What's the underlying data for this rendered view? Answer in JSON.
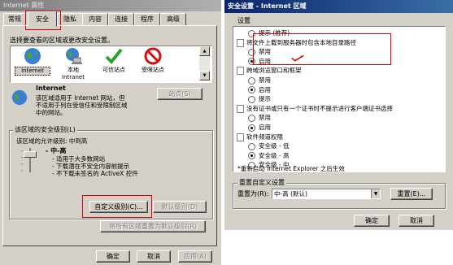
{
  "left": {
    "title": "Internet 属性",
    "tabs": [
      "常规",
      "安全",
      "隐私",
      "内容",
      "连接",
      "程序",
      "高级"
    ],
    "zone_prompt": "选择要查看的区域或更改安全设置。",
    "zones": [
      {
        "label": "Internet",
        "icon": "globe-icon"
      },
      {
        "label": "本地\nIntranet",
        "icon": "intranet-icon"
      },
      {
        "label": "可信站点",
        "icon": "checkmark-icon"
      },
      {
        "label": "受限站点",
        "icon": "restricted-icon"
      }
    ],
    "zone_title": "Internet",
    "zone_desc": "该区域适用于 Internet 网站，但\n不适用于列在受信任和受限制区域\n中的网站。",
    "sites_button": "站点(S)",
    "level_group_label": "该区域的安全级别(L)",
    "allowed_levels": "该区域的允许级别: 中到高",
    "level_name": "- 中-高",
    "level_desc": "- 适用于大多数网站\n- 下载潜在不安全内容前提示\n- 不下载未签名的 ActiveX 控件",
    "custom_button": "自定义级别(C)...",
    "default_button": "默认级别(D)",
    "reset_all_button": "将所有区域重置为默认级别(R)",
    "ok": "确定",
    "cancel": "取消",
    "apply": "应用(A)"
  },
  "right": {
    "title": "安全设置 - Internet 区域",
    "settings_label": "设置",
    "rows": [
      {
        "type": "radio",
        "on": false,
        "text": "提示 (推荐)",
        "indent": 2
      },
      {
        "type": "doc",
        "text": "将文件上载到服务器时包含本地目录路径",
        "indent": 1
      },
      {
        "type": "radio",
        "on": false,
        "text": "禁用",
        "indent": 2
      },
      {
        "type": "radio",
        "on": true,
        "text": "启用",
        "indent": 2
      },
      {
        "type": "doc",
        "text": "跨域浏览窗口和框架",
        "indent": 1
      },
      {
        "type": "radio",
        "on": false,
        "text": "禁用",
        "indent": 2
      },
      {
        "type": "radio",
        "on": true,
        "text": "启用",
        "indent": 2
      },
      {
        "type": "radio",
        "on": false,
        "text": "提示",
        "indent": 2
      },
      {
        "type": "doc",
        "text": "没有证书或只有一个证书时不提示进行客户端证书选择",
        "indent": 1
      },
      {
        "type": "radio",
        "on": false,
        "text": "禁用",
        "indent": 2
      },
      {
        "type": "radio",
        "on": true,
        "text": "启用",
        "indent": 2
      },
      {
        "type": "doc",
        "text": "软件频道权限",
        "indent": 1
      },
      {
        "type": "radio",
        "on": false,
        "text": "安全级 - 低",
        "indent": 2
      },
      {
        "type": "radio",
        "on": true,
        "text": "安全级 - 高",
        "indent": 2
      },
      {
        "type": "radio",
        "on": false,
        "text": "安全级 - 中",
        "indent": 2
      }
    ],
    "restart_note": "*重新启动 Internet Explorer 之后生效",
    "reset_group_label": "重置自定义设置",
    "reset_to_label": "重置为(R):",
    "reset_value": "中-高 (默认)",
    "reset_button": "重置(E)...",
    "ok": "确定",
    "cancel": "取消"
  }
}
